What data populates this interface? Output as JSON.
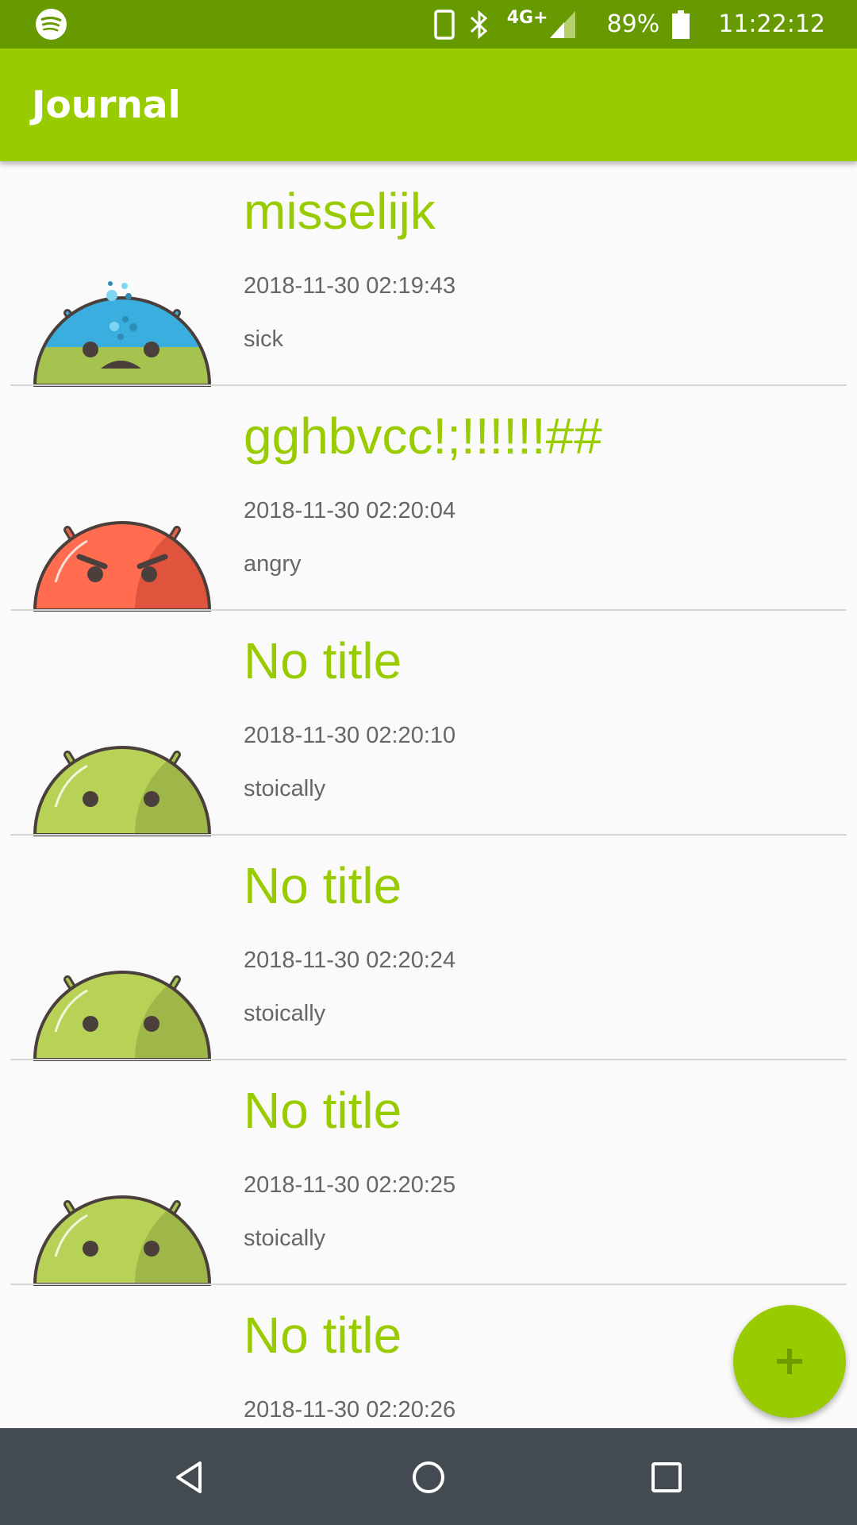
{
  "status_bar": {
    "network": "4G+",
    "battery": "89%",
    "time": "11:22:12",
    "icons": [
      "spotify-icon",
      "phone-icon",
      "bluetooth-icon",
      "signal-icon",
      "battery-icon"
    ]
  },
  "app_bar": {
    "title": "Journal"
  },
  "entries": [
    {
      "title": "misselijk",
      "date": "2018-11-30 02:19:43",
      "mood": "sick",
      "icon": "sick-android-icon"
    },
    {
      "title": "gghbvcc!;!!!!!!##",
      "date": "2018-11-30 02:20:04",
      "mood": "angry",
      "icon": "angry-android-icon"
    },
    {
      "title": "No title",
      "date": "2018-11-30 02:20:10",
      "mood": "stoically",
      "icon": "stoic-android-icon"
    },
    {
      "title": "No title",
      "date": "2018-11-30 02:20:24",
      "mood": "stoically",
      "icon": "stoic-android-icon"
    },
    {
      "title": "No title",
      "date": "2018-11-30 02:20:25",
      "mood": "stoically",
      "icon": "stoic-android-icon"
    },
    {
      "title": "No title",
      "date": "2018-11-30 02:20:26",
      "mood": "",
      "icon": ""
    }
  ],
  "fab": {
    "icon": "plus-icon"
  },
  "nav_bar": {
    "icons": [
      "back-icon",
      "home-icon",
      "recents-icon"
    ]
  },
  "colors": {
    "status_bar": "#679900",
    "app_bar": "#99cc00",
    "accent": "#99cc00",
    "nav_bar": "#434a51",
    "text_secondary": "#666666"
  }
}
